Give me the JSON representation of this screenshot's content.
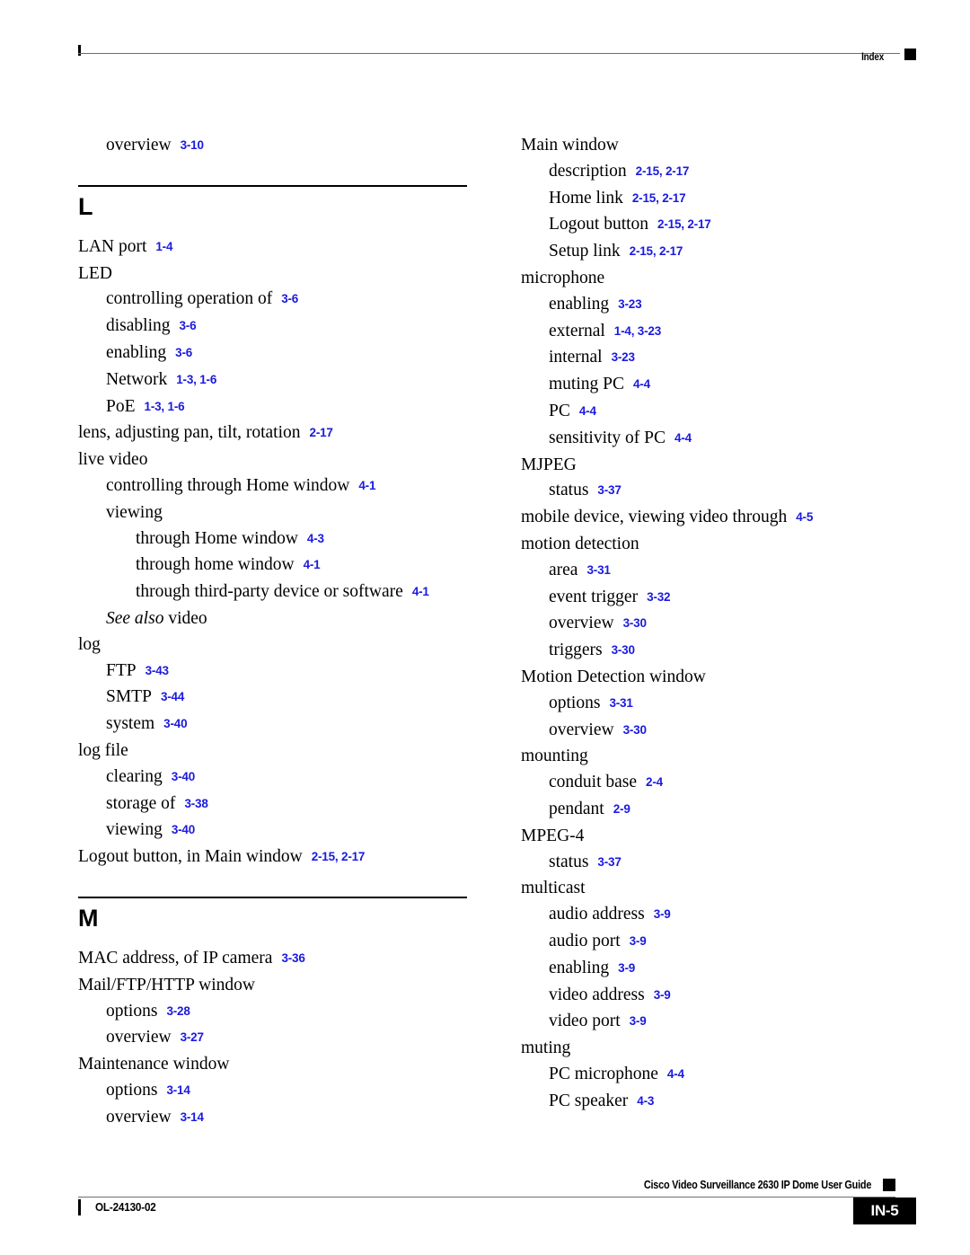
{
  "header": {
    "label": "Index",
    "marker_icon": "black-square-marker"
  },
  "footer": {
    "guide_title": "Cisco Video Surveillance 2630 IP Dome User Guide",
    "doc_id": "OL-24130-02",
    "page_number": "IN-5",
    "marker_icon": "black-square-marker"
  },
  "columns": [
    {
      "name": "left",
      "blocks": [
        {
          "type": "entries",
          "entries": [
            {
              "level": 1,
              "term": "overview",
              "ref": "3-10"
            }
          ]
        },
        {
          "type": "section",
          "letter": "L",
          "entries": [
            {
              "level": 0,
              "term": "LAN port",
              "ref": "1-4"
            },
            {
              "level": 0,
              "term": "LED",
              "ref": ""
            },
            {
              "level": 1,
              "term": "controlling operation of",
              "ref": "3-6"
            },
            {
              "level": 1,
              "term": "disabling",
              "ref": "3-6"
            },
            {
              "level": 1,
              "term": "enabling",
              "ref": "3-6"
            },
            {
              "level": 1,
              "term": "Network",
              "ref": "1-3, 1-6"
            },
            {
              "level": 1,
              "term": "PoE",
              "ref": "1-3, 1-6"
            },
            {
              "level": 0,
              "term": "lens, adjusting pan, tilt, rotation",
              "ref": "2-17"
            },
            {
              "level": 0,
              "term": "live video",
              "ref": ""
            },
            {
              "level": 1,
              "term": "controlling through Home window",
              "ref": "4-1"
            },
            {
              "level": 1,
              "term": "viewing",
              "ref": ""
            },
            {
              "level": 2,
              "term": "through Home window",
              "ref": "4-3"
            },
            {
              "level": 2,
              "term": "through home window",
              "ref": "4-1"
            },
            {
              "level": 2,
              "term": "through third-party device or software",
              "ref": "4-1"
            },
            {
              "level": 1,
              "term_italic": "See also",
              "term": " video",
              "ref": ""
            },
            {
              "level": 0,
              "term": "log",
              "ref": ""
            },
            {
              "level": 1,
              "term": "FTP",
              "ref": "3-43"
            },
            {
              "level": 1,
              "term": "SMTP",
              "ref": "3-44"
            },
            {
              "level": 1,
              "term": "system",
              "ref": "3-40"
            },
            {
              "level": 0,
              "term": "log file",
              "ref": ""
            },
            {
              "level": 1,
              "term": "clearing",
              "ref": "3-40"
            },
            {
              "level": 1,
              "term": "storage of",
              "ref": "3-38"
            },
            {
              "level": 1,
              "term": "viewing",
              "ref": "3-40"
            },
            {
              "level": 0,
              "term": "Logout button, in Main window",
              "ref": "2-15, 2-17"
            }
          ]
        },
        {
          "type": "section",
          "letter": "M",
          "entries": [
            {
              "level": 0,
              "term": "MAC address, of IP camera",
              "ref": "3-36"
            },
            {
              "level": 0,
              "term": "Mail/FTP/HTTP window",
              "ref": ""
            },
            {
              "level": 1,
              "term": "options",
              "ref": "3-28"
            },
            {
              "level": 1,
              "term": "overview",
              "ref": "3-27"
            },
            {
              "level": 0,
              "term": "Maintenance window",
              "ref": ""
            },
            {
              "level": 1,
              "term": "options",
              "ref": "3-14"
            },
            {
              "level": 1,
              "term": "overview",
              "ref": "3-14"
            }
          ]
        }
      ]
    },
    {
      "name": "right",
      "blocks": [
        {
          "type": "entries",
          "entries": [
            {
              "level": 0,
              "term": "Main window",
              "ref": ""
            },
            {
              "level": 1,
              "term": "description",
              "ref": "2-15, 2-17"
            },
            {
              "level": 1,
              "term": "Home link",
              "ref": "2-15, 2-17"
            },
            {
              "level": 1,
              "term": "Logout button",
              "ref": "2-15, 2-17"
            },
            {
              "level": 1,
              "term": "Setup link",
              "ref": "2-15, 2-17"
            },
            {
              "level": 0,
              "term": "microphone",
              "ref": ""
            },
            {
              "level": 1,
              "term": "enabling",
              "ref": "3-23"
            },
            {
              "level": 1,
              "term": "external",
              "ref": "1-4, 3-23"
            },
            {
              "level": 1,
              "term": "internal",
              "ref": "3-23"
            },
            {
              "level": 1,
              "term": "muting PC",
              "ref": "4-4"
            },
            {
              "level": 1,
              "term": "PC",
              "ref": "4-4"
            },
            {
              "level": 1,
              "term": "sensitivity of PC",
              "ref": "4-4"
            },
            {
              "level": 0,
              "term": "MJPEG",
              "ref": ""
            },
            {
              "level": 1,
              "term": "status",
              "ref": "3-37"
            },
            {
              "level": 0,
              "term": "mobile device, viewing video through",
              "ref": "4-5"
            },
            {
              "level": 0,
              "term": "motion detection",
              "ref": ""
            },
            {
              "level": 1,
              "term": "area",
              "ref": "3-31"
            },
            {
              "level": 1,
              "term": "event trigger",
              "ref": "3-32"
            },
            {
              "level": 1,
              "term": "overview",
              "ref": "3-30"
            },
            {
              "level": 1,
              "term": "triggers",
              "ref": "3-30"
            },
            {
              "level": 0,
              "term": "Motion Detection window",
              "ref": ""
            },
            {
              "level": 1,
              "term": "options",
              "ref": "3-31"
            },
            {
              "level": 1,
              "term": "overview",
              "ref": "3-30"
            },
            {
              "level": 0,
              "term": "mounting",
              "ref": ""
            },
            {
              "level": 1,
              "term": "conduit base",
              "ref": "2-4"
            },
            {
              "level": 1,
              "term": "pendant",
              "ref": "2-9"
            },
            {
              "level": 0,
              "term": "MPEG-4",
              "ref": ""
            },
            {
              "level": 1,
              "term": "status",
              "ref": "3-37"
            },
            {
              "level": 0,
              "term": "multicast",
              "ref": ""
            },
            {
              "level": 1,
              "term": "audio address",
              "ref": "3-9"
            },
            {
              "level": 1,
              "term": "audio port",
              "ref": "3-9"
            },
            {
              "level": 1,
              "term": "enabling",
              "ref": "3-9"
            },
            {
              "level": 1,
              "term": "video address",
              "ref": "3-9"
            },
            {
              "level": 1,
              "term": "video port",
              "ref": "3-9"
            },
            {
              "level": 0,
              "term": "muting",
              "ref": ""
            },
            {
              "level": 1,
              "term": "PC microphone",
              "ref": "4-4"
            },
            {
              "level": 1,
              "term": "PC speaker",
              "ref": "4-3"
            }
          ]
        }
      ]
    }
  ]
}
